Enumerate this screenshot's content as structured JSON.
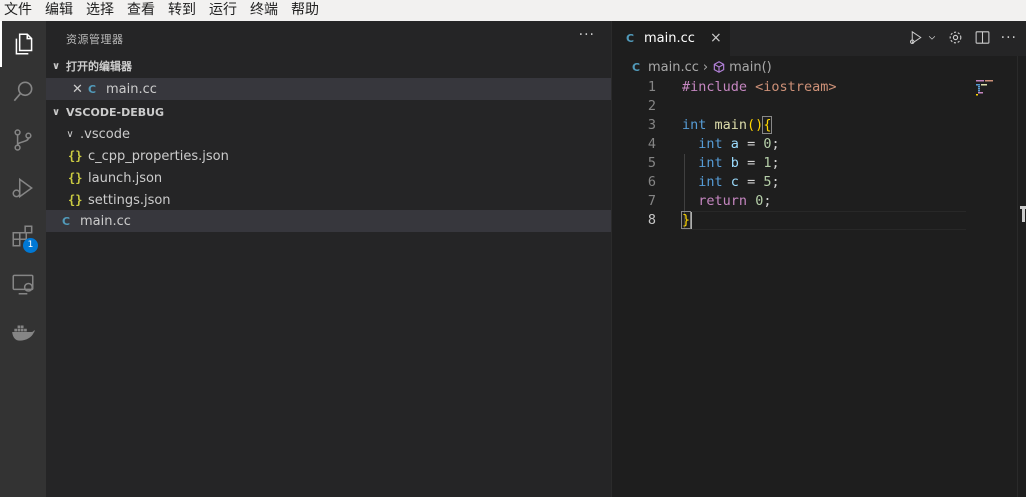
{
  "menubar": {
    "items": [
      "文件",
      "编辑",
      "选择",
      "查看",
      "转到",
      "运行",
      "终端",
      "帮助"
    ]
  },
  "activitybar": {
    "items": [
      "explorer-icon",
      "search-icon",
      "source-control-icon",
      "run-debug-icon",
      "extensions-icon",
      "remote-explorer-icon",
      "docker-icon"
    ],
    "extensions_badge": "1",
    "accent": "#0078d4"
  },
  "sidebar": {
    "title": "资源管理器",
    "more": "···",
    "open_editors": {
      "label": "打开的编辑器",
      "items": [
        {
          "name": "main.cc",
          "icon": "C"
        }
      ]
    },
    "workspace": {
      "label": "VSCODE-DEBUG",
      "folder": ".vscode",
      "folder_files": [
        {
          "name": "c_cpp_properties.json",
          "icon": "{}"
        },
        {
          "name": "launch.json",
          "icon": "{}"
        },
        {
          "name": "settings.json",
          "icon": "{}"
        }
      ],
      "root_file": {
        "name": "main.cc",
        "icon": "C"
      }
    }
  },
  "editor": {
    "tab": {
      "label": "main.cc",
      "close": "×"
    },
    "breadcrumb": {
      "file": "main.cc",
      "symbol": "main()"
    },
    "line_numbers": [
      "1",
      "2",
      "3",
      "4",
      "5",
      "6",
      "7",
      "8"
    ],
    "current_line": "8"
  }
}
